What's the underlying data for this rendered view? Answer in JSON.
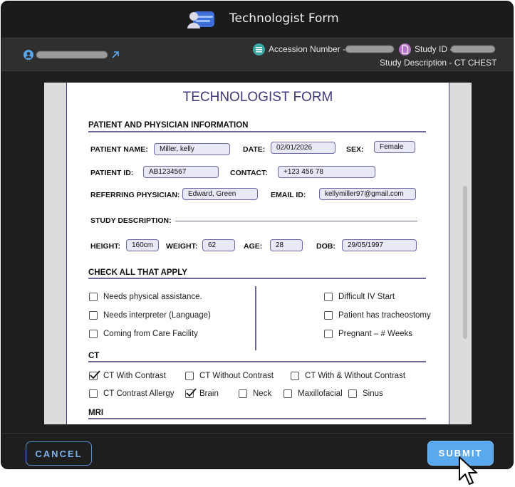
{
  "window": {
    "title": "Technologist Form",
    "accession_label": "Accession Number -",
    "study_id_label": "Study ID -",
    "study_description": "Study Description - CT CHEST"
  },
  "form": {
    "title": "TECHNOLOGIST FORM",
    "section_patient": "PATIENT AND PHYSICIAN INFORMATION",
    "patient_name_label": "PATIENT NAME:",
    "patient_name": "Miller, kelly",
    "date_label": "DATE:",
    "date": "02/01/2026",
    "sex_label": "SEX:",
    "sex": "Female",
    "patient_id_label": "PATIENT ID:",
    "patient_id": "AB1234567",
    "contact_label": "CONTACT:",
    "contact": "+123 456 78",
    "referring_label": "REFERRING PHYSICIAN:",
    "referring": "Edward, Green",
    "email_label": "EMAIL ID:",
    "email": "kellymiller97@gmail.com",
    "study_desc_label": "STUDY DESCRIPTION:",
    "height_label": "HEIGHT:",
    "height": "160cm",
    "weight_label": "WEIGHT:",
    "weight": "62",
    "age_label": "AGE:",
    "age": "28",
    "dob_label": "DOB:",
    "dob": "29/05/1997",
    "section_check": "CHECK ALL THAT APPLY",
    "check_left": [
      {
        "label": "Needs physical assistance.",
        "checked": false
      },
      {
        "label": "Needs interpreter (Language)",
        "checked": false
      },
      {
        "label": "Coming from Care Facility",
        "checked": false
      }
    ],
    "check_right": [
      {
        "label": "Difficult IV Start",
        "checked": false
      },
      {
        "label": "Patient has tracheostomy",
        "checked": false
      },
      {
        "label": "Pregnant – # Weeks",
        "checked": false
      }
    ],
    "section_ct": "CT",
    "ct_row1": [
      {
        "label": "CT With Contrast",
        "checked": true
      },
      {
        "label": "CT Without Contrast",
        "checked": false
      },
      {
        "label": "CT With & Without Contrast",
        "checked": false
      }
    ],
    "ct_row2": [
      {
        "label": "CT Contrast Allergy",
        "checked": false
      },
      {
        "label": "Brain",
        "checked": true
      },
      {
        "label": "Neck",
        "checked": false
      },
      {
        "label": "Maxillofacial",
        "checked": false
      },
      {
        "label": "Sinus",
        "checked": false
      }
    ],
    "section_mri": "MRI"
  },
  "footer": {
    "cancel_label": "CANCEL",
    "submit_label": "SUBMIT"
  },
  "colors": {
    "accent": "#5aa8ee",
    "form_accent": "#3f3a7a",
    "field_fill": "#e9e8f7"
  }
}
